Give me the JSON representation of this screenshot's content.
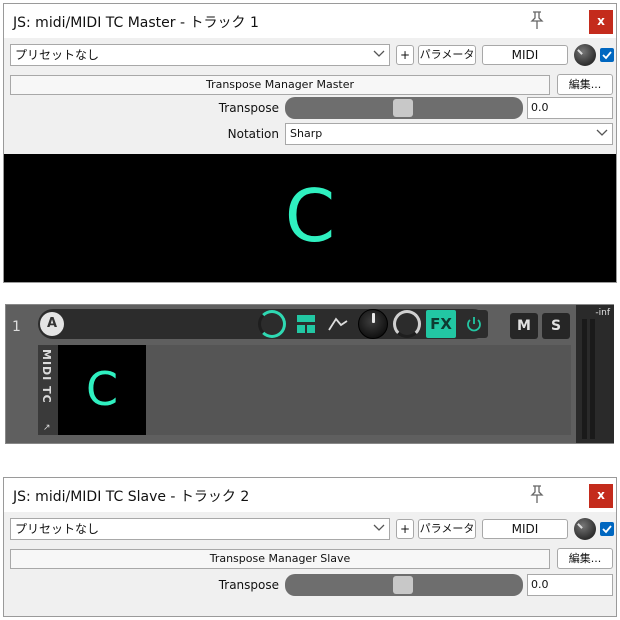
{
  "master": {
    "title": "JS: midi/MIDI TC Master - トラック 1",
    "close_label": "x",
    "preset": "プリセットなし",
    "plus_label": "+",
    "param_label": "パラメータ",
    "midi_label": "MIDI",
    "header": "Transpose Manager Master",
    "edit_label": "編集...",
    "transpose_label": "Transpose",
    "transpose_value": "0.0",
    "notation_label": "Notation",
    "notation_value": "Sharp",
    "display_note": "C"
  },
  "track": {
    "number": "1",
    "rec_arm_label": "A",
    "fx_label": "FX",
    "mute_label": "M",
    "solo_label": "S",
    "meter_label": "-inf",
    "fx_name": "MIDI TC",
    "fx_display": "C"
  },
  "slave": {
    "title": "JS: midi/MIDI TC Slave - トラック 2",
    "close_label": "x",
    "preset": "プリセットなし",
    "plus_label": "+",
    "param_label": "パラメータ",
    "midi_label": "MIDI",
    "header": "Transpose Manager Slave",
    "edit_label": "編集...",
    "transpose_label": "Transpose",
    "transpose_value": "0.0"
  },
  "colors": {
    "accent": "#2ff0c0",
    "fx_active": "#22c7a3",
    "close": "#c42b1c",
    "checkbox": "#0067c0"
  }
}
